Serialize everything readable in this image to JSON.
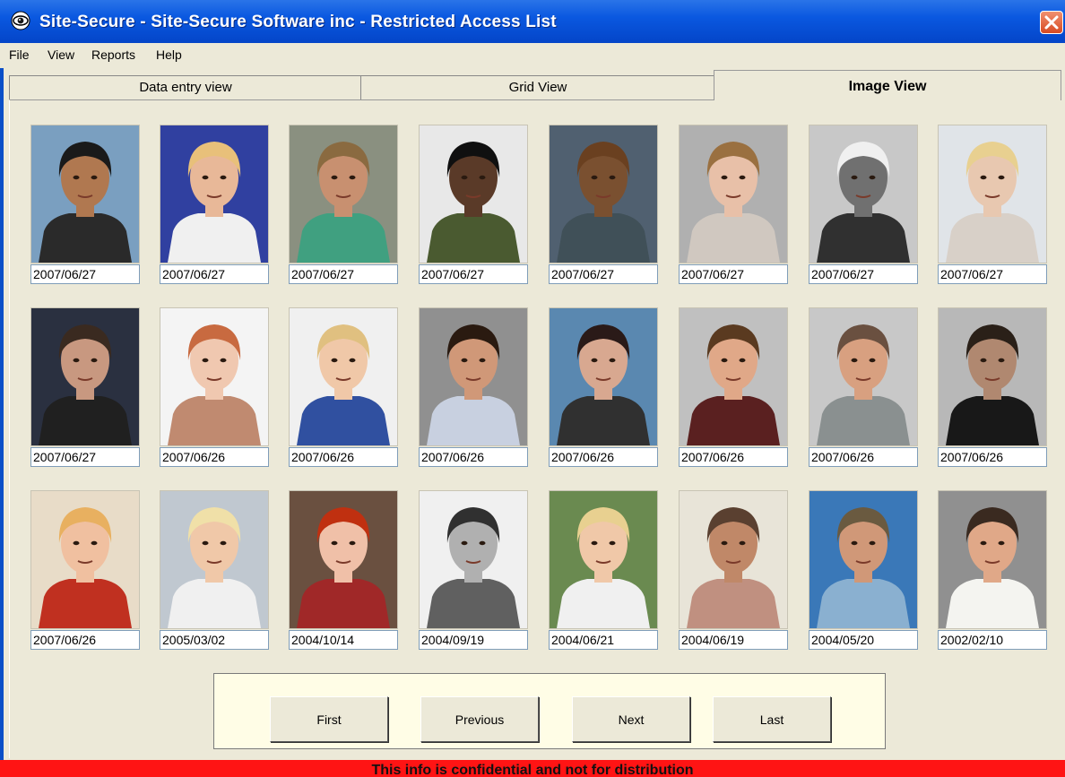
{
  "window": {
    "title": "Site-Secure - Site-Secure Software inc - Restricted Access List",
    "close_icon": "close-icon",
    "app_icon": "eye-icon"
  },
  "menu": [
    "File",
    "View",
    "Reports",
    "Help"
  ],
  "tabs": {
    "data_entry": "Data entry view",
    "grid": "Grid View",
    "image": "Image View",
    "active": "Image View"
  },
  "cards": [
    {
      "date": "2007/06/27",
      "photo": {
        "bg": "#7a9fc0",
        "skin": "#b07850",
        "hair": "#1a1a1a",
        "clothes": "#2a2a2a"
      }
    },
    {
      "date": "2007/06/27",
      "photo": {
        "bg": "#3040a0",
        "skin": "#e8b898",
        "hair": "#e8c07a",
        "clothes": "#f0f0f0"
      }
    },
    {
      "date": "2007/06/27",
      "photo": {
        "bg": "#8a9080",
        "skin": "#c89070",
        "hair": "#8a6a40",
        "clothes": "#40a080"
      }
    },
    {
      "date": "2007/06/27",
      "photo": {
        "bg": "#e8e8e8",
        "skin": "#5a3a28",
        "hair": "#101010",
        "clothes": "#4a5a30"
      }
    },
    {
      "date": "2007/06/27",
      "photo": {
        "bg": "#506070",
        "skin": "#7a5030",
        "hair": "#6a4020",
        "clothes": "#405058"
      }
    },
    {
      "date": "2007/06/27",
      "photo": {
        "bg": "#b0b0b0",
        "skin": "#e8c0a8",
        "hair": "#9a7040",
        "clothes": "#d0c8c0"
      }
    },
    {
      "date": "2007/06/27",
      "photo": {
        "bg": "#c8c8c8",
        "skin": "#707070",
        "hair": "#f0f0f0",
        "clothes": "#303030"
      }
    },
    {
      "date": "2007/06/27",
      "photo": {
        "bg": "#e0e4e8",
        "skin": "#e8c8b0",
        "hair": "#e8d090",
        "clothes": "#d8d0c8"
      }
    },
    {
      "date": "2007/06/27",
      "photo": {
        "bg": "#2a3040",
        "skin": "#c89880",
        "hair": "#3a2a20",
        "clothes": "#202020"
      }
    },
    {
      "date": "2007/06/26",
      "photo": {
        "bg": "#f4f4f4",
        "skin": "#f0c8b0",
        "hair": "#c86a40",
        "clothes": "#c08a70"
      }
    },
    {
      "date": "2007/06/26",
      "photo": {
        "bg": "#f0f0f0",
        "skin": "#f0c8a8",
        "hair": "#e0c080",
        "clothes": "#3050a0"
      }
    },
    {
      "date": "2007/06/26",
      "photo": {
        "bg": "#909090",
        "skin": "#d09878",
        "hair": "#2a1a10",
        "clothes": "#c8d0e0"
      }
    },
    {
      "date": "2007/06/26",
      "photo": {
        "bg": "#5a88b0",
        "skin": "#d8a890",
        "hair": "#2a1a18",
        "clothes": "#303030"
      }
    },
    {
      "date": "2007/06/26",
      "photo": {
        "bg": "#c0c0c0",
        "skin": "#e0a888",
        "hair": "#5a3a20",
        "clothes": "#5a2020"
      }
    },
    {
      "date": "2007/06/26",
      "photo": {
        "bg": "#c8c8c8",
        "skin": "#d8a080",
        "hair": "#6a5040",
        "clothes": "#8a9090"
      }
    },
    {
      "date": "2007/06/26",
      "photo": {
        "bg": "#b8b8b8",
        "skin": "#b08870",
        "hair": "#2a2018",
        "clothes": "#181818"
      }
    },
    {
      "date": "2007/06/26",
      "photo": {
        "bg": "#e8dcc8",
        "skin": "#f0c0a0",
        "hair": "#e8b060",
        "clothes": "#c03020"
      }
    },
    {
      "date": "2005/03/02",
      "photo": {
        "bg": "#c0c8d0",
        "skin": "#f0c8a8",
        "hair": "#f0e0a8",
        "clothes": "#f0f0f0"
      }
    },
    {
      "date": "2004/10/14",
      "photo": {
        "bg": "#6a5040",
        "skin": "#f0c0a8",
        "hair": "#c03010",
        "clothes": "#a02828"
      }
    },
    {
      "date": "2004/09/19",
      "photo": {
        "bg": "#f0f0f0",
        "skin": "#b0b0b0",
        "hair": "#303030",
        "clothes": "#606060"
      }
    },
    {
      "date": "2004/06/21",
      "photo": {
        "bg": "#6a8a50",
        "skin": "#f0c8a8",
        "hair": "#e8d090",
        "clothes": "#f0f0f0"
      }
    },
    {
      "date": "2004/06/19",
      "photo": {
        "bg": "#e8e4d8",
        "skin": "#c08868",
        "hair": "#5a4030",
        "clothes": "#c09080"
      }
    },
    {
      "date": "2004/05/20",
      "photo": {
        "bg": "#3a78b8",
        "skin": "#d09878",
        "hair": "#6a5a40",
        "clothes": "#8ab0d0"
      }
    },
    {
      "date": "2002/02/10",
      "photo": {
        "bg": "#909090",
        "skin": "#e0a888",
        "hair": "#3a2a20",
        "clothes": "#f4f4f0"
      }
    }
  ],
  "nav": {
    "first": "First",
    "previous": "Previous",
    "next": "Next",
    "last": "Last"
  },
  "status": {
    "text": "This info is confidential and not for distribution",
    "color": "#ff1414"
  }
}
